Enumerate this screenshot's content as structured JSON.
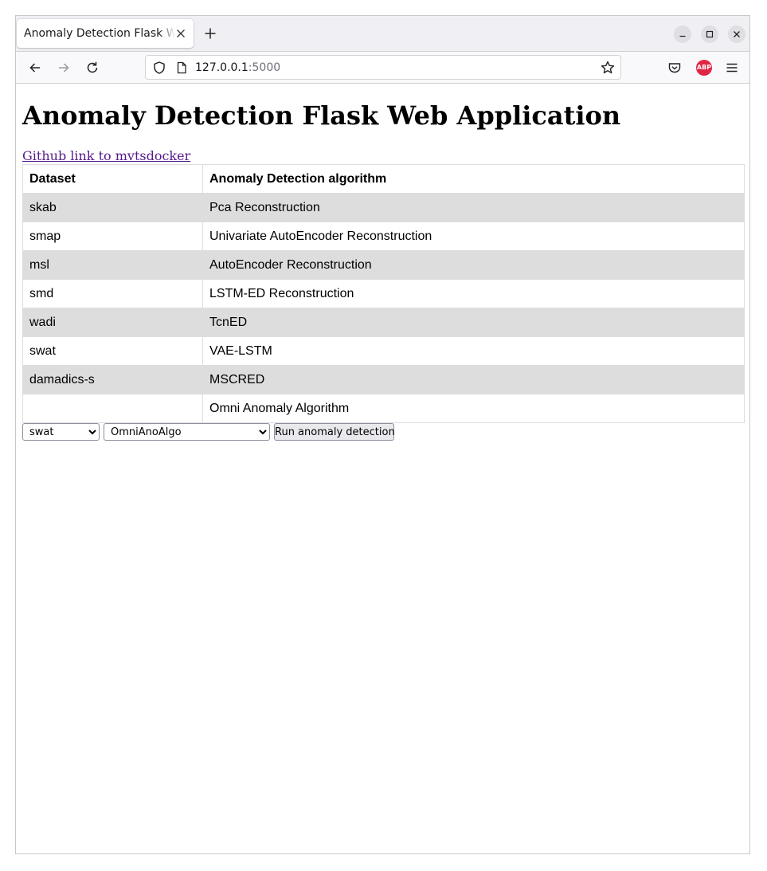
{
  "browser": {
    "tab_title": "Anomaly Detection Flask Web Application",
    "url_host": "127.0.0.1",
    "url_port": ":5000",
    "adblock_label": "ABP"
  },
  "page": {
    "heading": "Anomaly Detection Flask Web Application",
    "github_link_text": "Github link to mvtsdocker",
    "table": {
      "headers": [
        "Dataset",
        "Anomaly Detection algorithm"
      ],
      "rows": [
        [
          "skab",
          "Pca Reconstruction"
        ],
        [
          "smap",
          "Univariate AutoEncoder Reconstruction"
        ],
        [
          "msl",
          "AutoEncoder Reconstruction"
        ],
        [
          "smd",
          "LSTM-ED Reconstruction"
        ],
        [
          "wadi",
          "TcnED"
        ],
        [
          "swat",
          "VAE-LSTM"
        ],
        [
          "damadics-s",
          "MSCRED"
        ],
        [
          "",
          "Omni Anomaly Algorithm"
        ]
      ]
    },
    "dataset_select_value": "swat",
    "algorithm_select_value": "OmniAnoAlgo",
    "run_button_label": "Run anomaly detection"
  },
  "icons": [
    "close-icon",
    "plus-icon",
    "minimize-icon",
    "maximize-icon",
    "back-icon",
    "forward-icon",
    "reload-icon",
    "shield-icon",
    "page-icon",
    "star-icon",
    "pocket-icon",
    "adblock-icon",
    "menu-icon"
  ],
  "colors": {
    "link_visited": "#551a8b",
    "row_shade": "#dddddd",
    "adblock": "#e02545"
  }
}
